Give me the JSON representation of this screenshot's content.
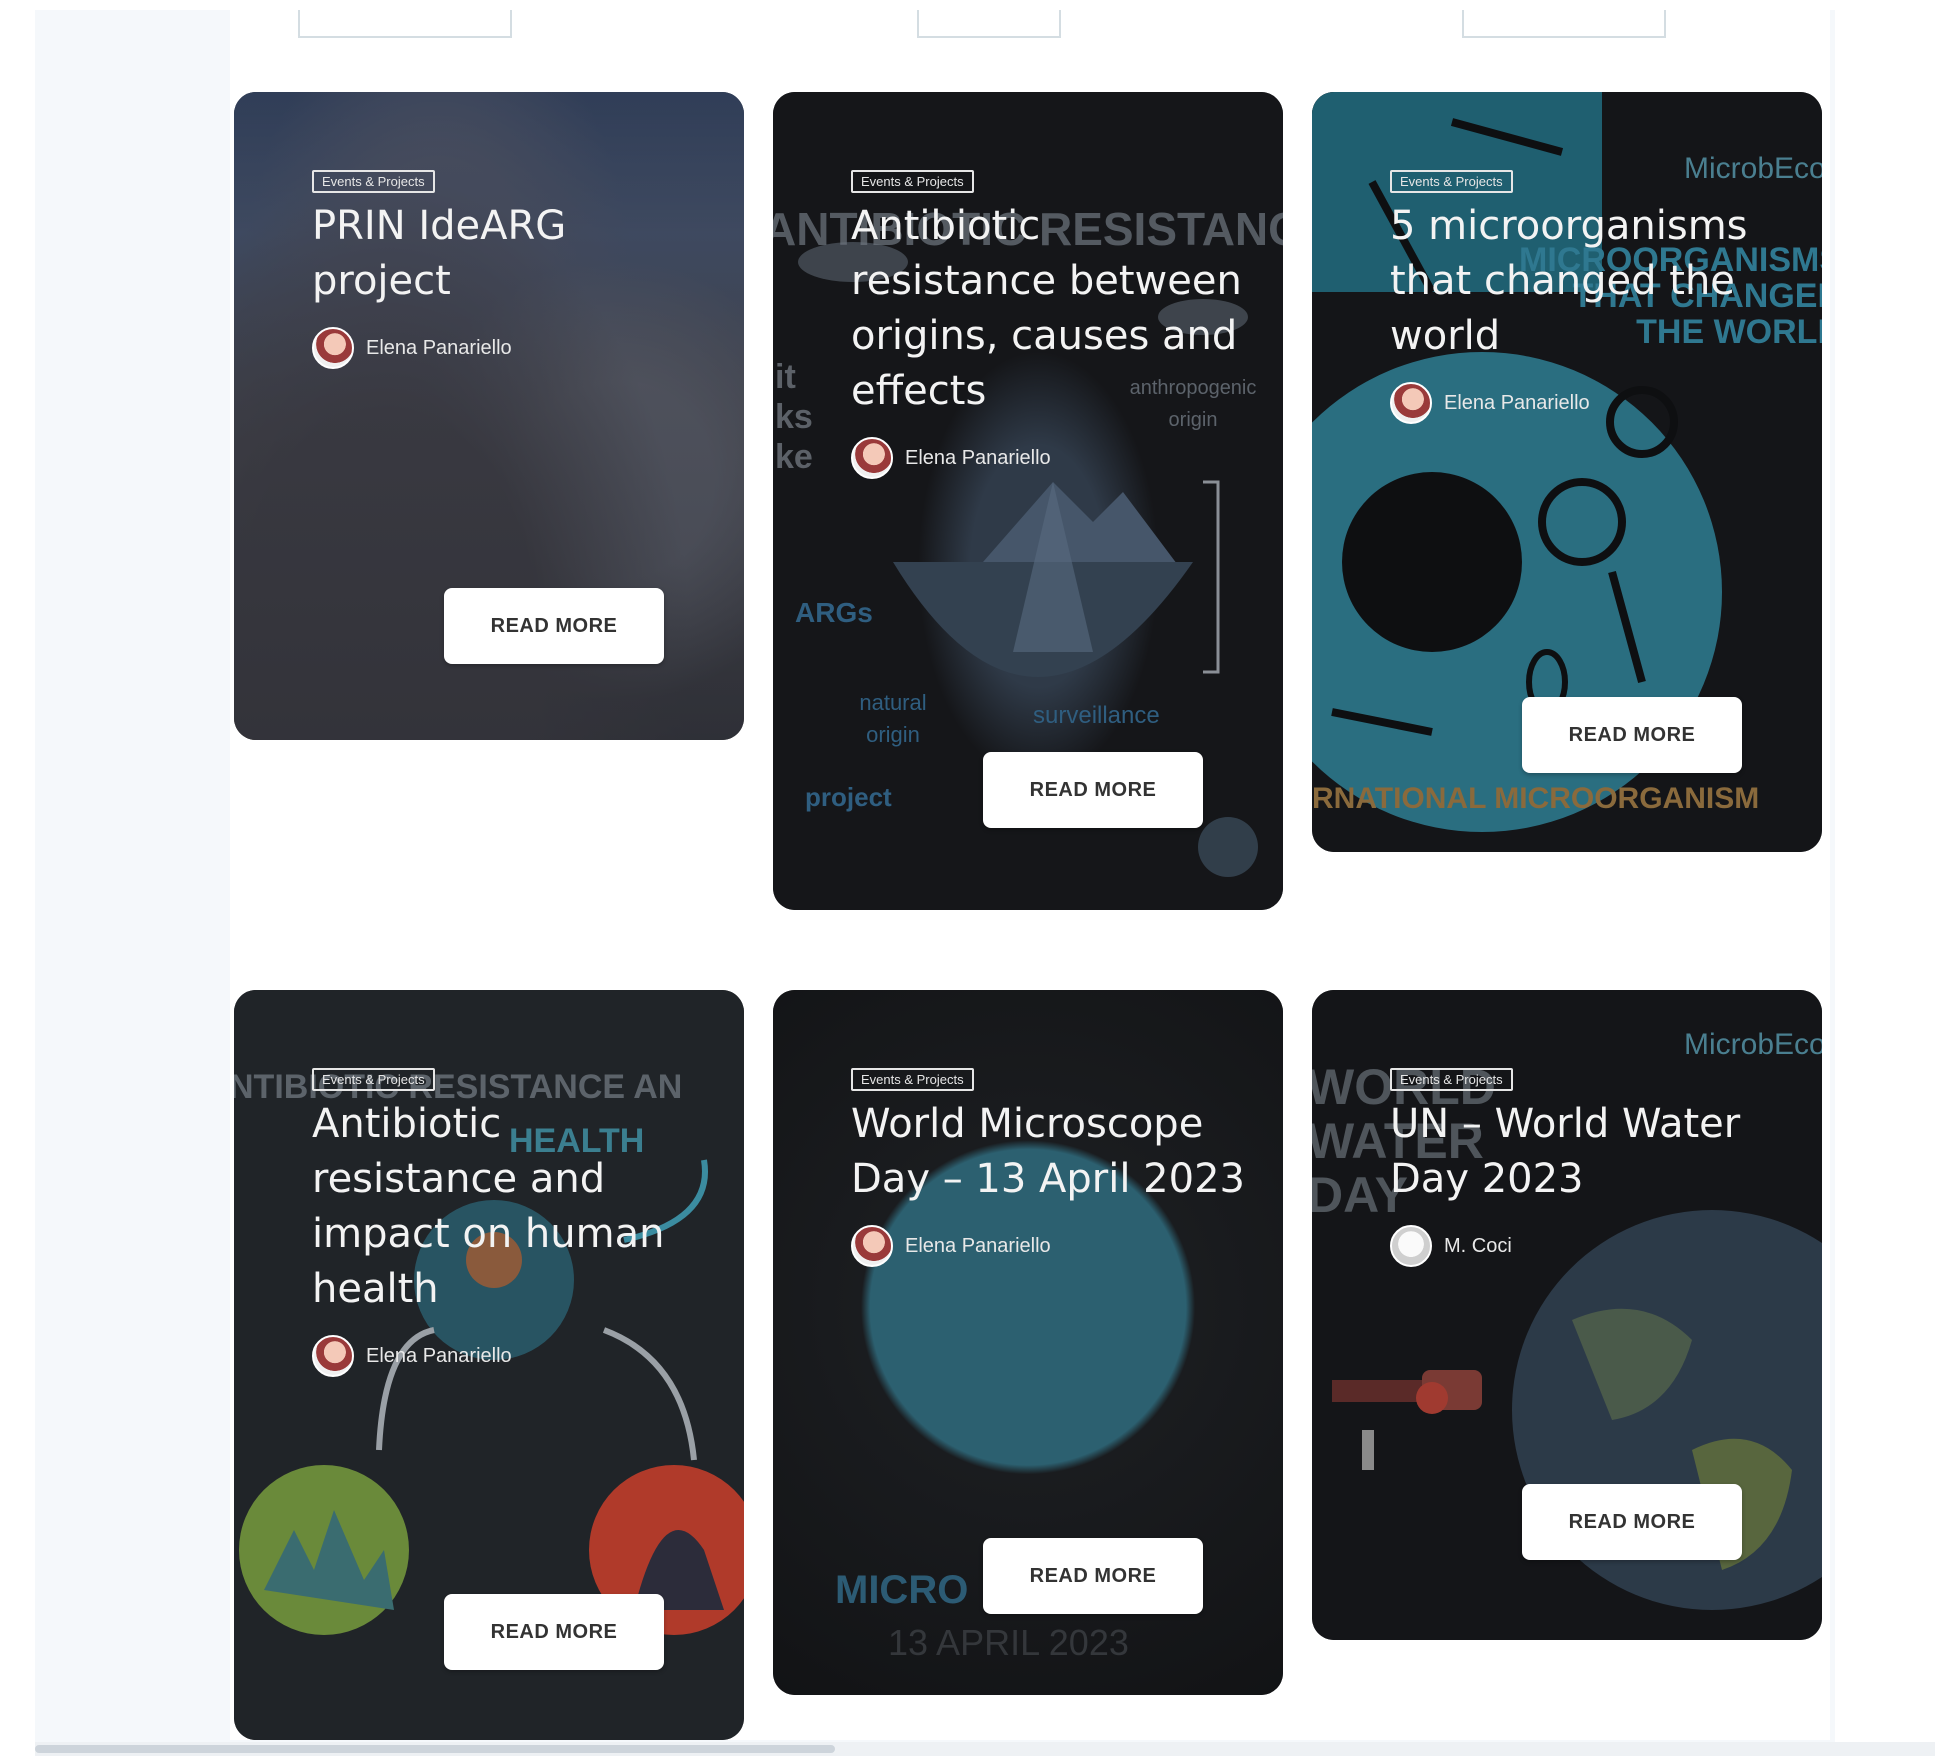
{
  "cards": [
    {
      "tag": "Events & Projects",
      "title": "PRIN IdeARG project",
      "author": "Elena Panariello",
      "button": "READ MORE"
    },
    {
      "tag": "Events & Projects",
      "title": "Antibiotic resistance between origins, causes and effects",
      "author": "Elena Panariello",
      "button": "READ MORE",
      "bg_text": {
        "headline": "ANTIBIOTIC RESISTANCE",
        "side": "it ks ke",
        "anthro": "anthropogenic origin",
        "args": "ARGs",
        "natural": "natural origin",
        "surveillance": "surveillance",
        "project": "project"
      }
    },
    {
      "tag": "Events & Projects",
      "title": "5 microorganisms that changed the world",
      "author": "Elena Panariello",
      "button": "READ MORE",
      "bg_text": {
        "brand": "MicrobEco",
        "headline": "MICROORGANISMS THAT CHANGED THE WORLD",
        "footer": "RNATIONAL MICROORGANISM"
      }
    },
    {
      "tag": "Events & Projects",
      "title": "Antibiotic resistance and impact on human health",
      "author": "Elena Panariello",
      "button": "READ MORE",
      "bg_text": {
        "headline": "NTIBIOTIC RESISTANCE AN",
        "health": "HEALTH"
      }
    },
    {
      "tag": "Events & Projects",
      "title": "World Microscope Day – 13 April 2023",
      "author": "Elena Panariello",
      "button": "READ MORE",
      "bg_text": {
        "micro": "MICRO",
        "date": "13 APRIL 2023"
      }
    },
    {
      "tag": "Events & Projects",
      "title": "UN – World Water Day 2023",
      "author": "M. Coci",
      "button": "READ MORE",
      "bg_text": {
        "brand": "MicrobEco",
        "headline": "WORLD WATER DAY"
      }
    }
  ],
  "colors": {
    "card_bg": "#1a1c1f",
    "teal": "#2e6e80",
    "button_bg": "#ffffff"
  }
}
